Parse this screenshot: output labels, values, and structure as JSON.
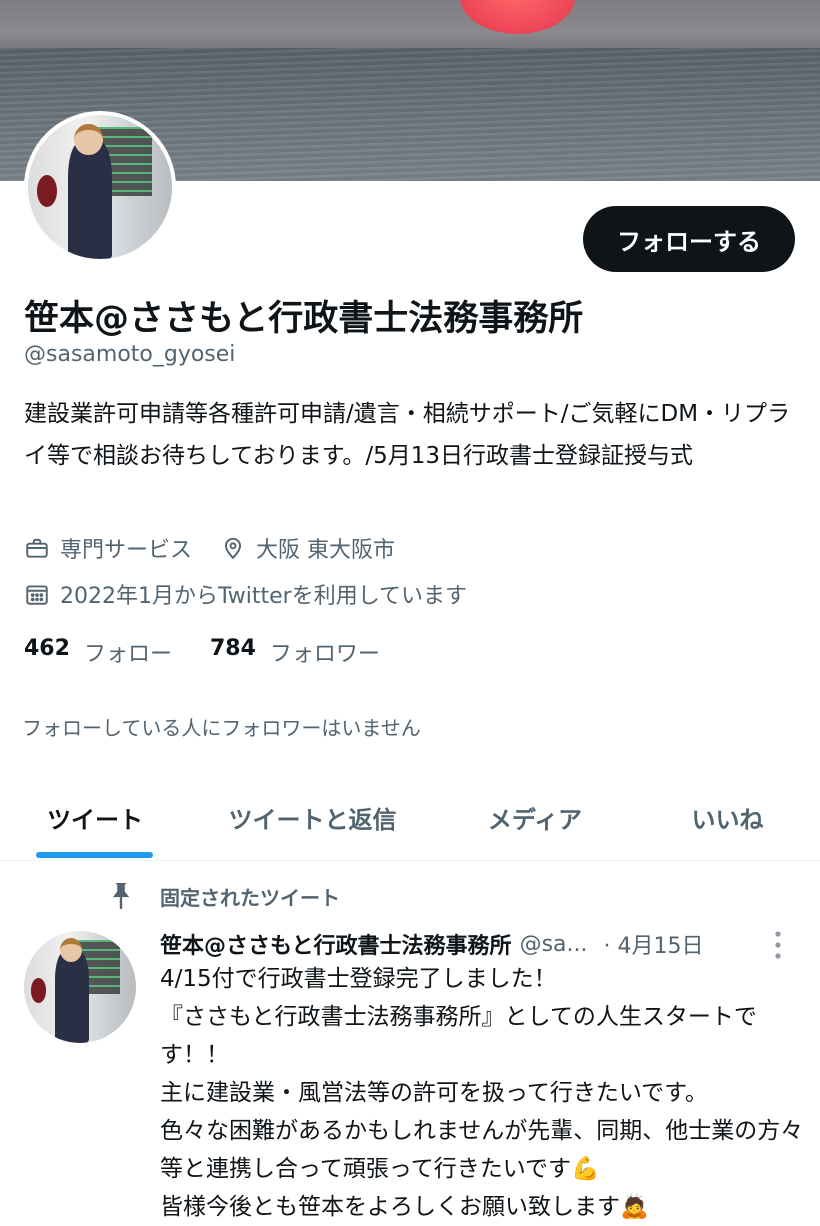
{
  "profile": {
    "display_name": "笹本@ささもと行政書士法務事務所",
    "handle": "@sasamoto_gyosei",
    "follow_button_label": "フォローする",
    "bio": "建設業許可申請等各種許可申請/遺言・相続サポート/ご気軽にDM・リプライ等で相談お待ちしております。/5月13日行政書士登録証授与式",
    "category": "専門サービス",
    "location": "大阪 東大阪市",
    "joined": "2022年1月からTwitterを利用しています",
    "following_count": "462",
    "following_label": "フォロー",
    "followers_count": "784",
    "followers_label": "フォロワー",
    "no_mutual_note": "フォローしている人にフォロワーはいません"
  },
  "tabs": [
    {
      "label": "ツイート",
      "active": true
    },
    {
      "label": "ツイートと返信",
      "active": false
    },
    {
      "label": "メディア",
      "active": false
    },
    {
      "label": "いいね",
      "active": false
    }
  ],
  "pinned_tweet": {
    "pinned_label": "固定されたツイート",
    "author_name": "笹本@ささもと行政書士法務事務所",
    "author_handle": "@sa...",
    "date": "· 4月15日",
    "text": "4/15付で行政書士登録完了しました！\n『ささもと行政書士法務事務所』としての人生スタートです！！\n主に建設業・風営法等の許可を扱って行きたいです。\n色々な困難があるかもしれませんが先輩、同期、他士業の方々等と連携し合って頑張って行きたいです💪\n皆様今後とも笹本をよろしくお願い致します🙇"
  },
  "icons": {
    "category": "briefcase-icon",
    "location": "location-pin-icon",
    "joined": "calendar-icon",
    "pinned": "pin-icon",
    "more": "more-vertical-icon"
  },
  "colors": {
    "accent": "#1d9bf0",
    "text": "#0f1419",
    "secondary": "#536471",
    "button_bg": "#0f1419"
  }
}
